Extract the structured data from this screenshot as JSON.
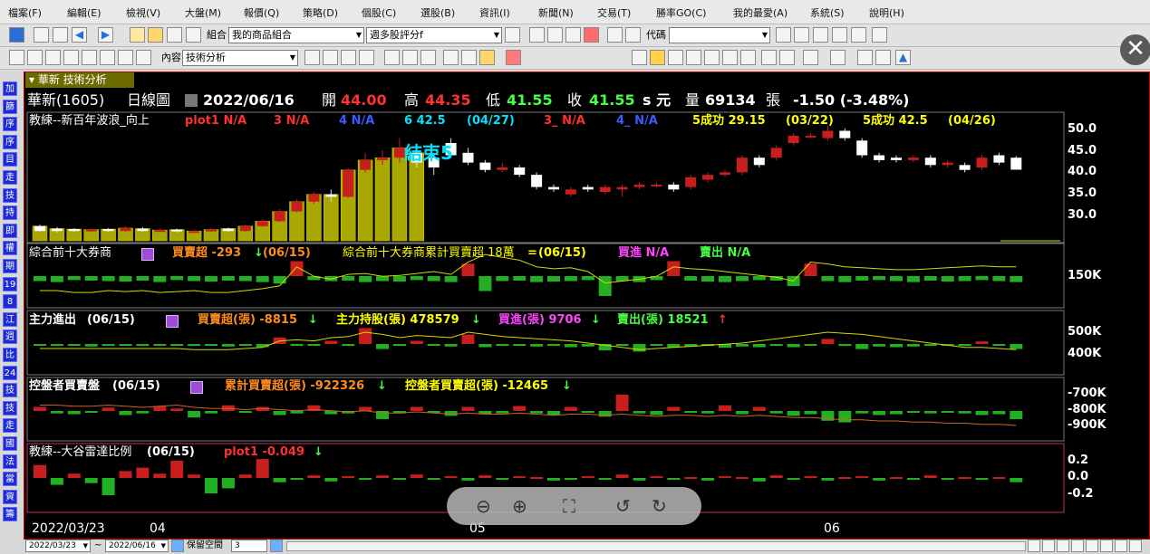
{
  "menu": [
    "檔案(F)",
    "編輯(E)",
    "檢視(V)",
    "大盤(M)",
    "報價(Q)",
    "策略(D)",
    "個股(C)",
    "選股(B)",
    "資訊(I)",
    "新聞(N)",
    "交易(T)",
    "勝率GO(C)",
    "我的最愛(A)",
    "系統(S)",
    "說明(H)"
  ],
  "toolbar1": {
    "combo_label": "組合",
    "combo_value": "我的商品組合",
    "strategy_value": "週多股評分f",
    "code_label": "代碼",
    "code_value": ""
  },
  "toolbar2": {
    "content_label": "內容",
    "content_value": "技術分析"
  },
  "left_buttons": [
    "加",
    "篩",
    "序",
    "序",
    "目",
    "走",
    "技",
    "持",
    "即",
    "權",
    "期",
    "19",
    "8",
    "江",
    "週",
    "比",
    "24",
    "技",
    "技",
    "走",
    "國",
    "法",
    "當",
    "資",
    "籌"
  ],
  "tab": {
    "title": "華新 技術分析"
  },
  "header": {
    "name": "華新(1605)",
    "period": "日線圖",
    "date": "2022/06/16",
    "open_label": "開",
    "open": "44.00",
    "high_label": "高",
    "high": "44.35",
    "low_label": "低",
    "low": "41.55",
    "close_label": "收",
    "close": "41.55",
    "unit": "s 元",
    "vol_label": "量",
    "vol": "69134",
    "vol_unit": "張",
    "change": "-1.50 (-3.48%)"
  },
  "panel1": {
    "title": "教練--新百年波浪_向上",
    "items": [
      {
        "text": "plot1 N/A",
        "color": "#ff3030"
      },
      {
        "text": "3 N/A",
        "color": "#ff3030"
      },
      {
        "text": "4 N/A",
        "color": "#3a5bff"
      },
      {
        "text": "6 42.5",
        "color": "#00e5ff"
      },
      {
        "text": "(04/27)",
        "color": "#00e5ff"
      },
      {
        "text": "3_ N/A",
        "color": "#ff3030"
      },
      {
        "text": "4_ N/A",
        "color": "#3a5bff"
      },
      {
        "text": "5成功 29.15",
        "color": "#ffff00"
      },
      {
        "text": "(03/22)",
        "color": "#ffff00"
      },
      {
        "text": "5成功 42.5",
        "color": "#ffff00"
      },
      {
        "text": "(04/26)",
        "color": "#ffff00"
      }
    ],
    "marker": "結束5",
    "yticks": [
      "50.0",
      "45.0",
      "40.0",
      "35.0",
      "30.0"
    ]
  },
  "panel2": {
    "title": "綜合前十大券商",
    "items": [
      {
        "text": "買賣超 -293",
        "color": "#ff8c1a"
      },
      {
        "text": "(06/15)",
        "color": "#ff8c1a"
      },
      {
        "text": "綜合前十大券商累計買賣超 18萬",
        "color": "#ffff00"
      },
      {
        "text": "(06/15)",
        "color": "#ffff00"
      },
      {
        "text": "買進 N/A",
        "color": "#ff44ff"
      },
      {
        "text": "賣出 N/A",
        "color": "#44ff44"
      }
    ],
    "yticks": [
      "150K"
    ]
  },
  "panel3": {
    "title": "主力進出",
    "date": "(06/15)",
    "items": [
      {
        "text": "買賣超(張) -8815",
        "color": "#ff8c1a"
      },
      {
        "text": "主力持股(張) 478579",
        "color": "#ffff00"
      },
      {
        "text": "買進(張) 9706",
        "color": "#ff44ff"
      },
      {
        "text": "賣出(張) 18521",
        "color": "#44ff44"
      }
    ],
    "yticks": [
      "500K",
      "400K"
    ]
  },
  "panel4": {
    "title": "控盤者買賣盤",
    "date": "(06/15)",
    "items": [
      {
        "text": "累計買賣超(張) -922326",
        "color": "#ff8c1a"
      },
      {
        "text": "控盤者買賣超(張) -12465",
        "color": "#ffff00"
      }
    ],
    "yticks": [
      "-700K",
      "-800K",
      "-900K"
    ]
  },
  "panel5": {
    "title": "教練--大谷雷達比例",
    "date": "(06/15)",
    "items": [
      {
        "text": "plot1 -0.049",
        "color": "#ff3030"
      }
    ],
    "yticks": [
      "0.2",
      "0.0",
      "-0.2"
    ]
  },
  "xaxis": [
    "2022/03/23",
    "04",
    "05",
    "06"
  ],
  "bottom": {
    "from": "2022/03/23",
    "tilde": "~",
    "to": "2022/06/16",
    "reserve_label": "保留空間",
    "reserve_value": "3"
  },
  "colors": {
    "up": "#c81e1e",
    "down": "#ffffff",
    "highlight": "#a8a800",
    "grid": "#7a7a7a"
  },
  "chart_data": {
    "type": "candlestick",
    "title": "華新(1605) 日線圖",
    "ylim": [
      27,
      52
    ],
    "highlight_count": 23,
    "candles": [
      {
        "o": 30,
        "c": 29,
        "h": 30.3,
        "l": 28.8
      },
      {
        "o": 29.5,
        "c": 29,
        "h": 29.8,
        "l": 28.7
      },
      {
        "o": 29.4,
        "c": 29,
        "h": 29.6,
        "l": 28.8
      },
      {
        "o": 29,
        "c": 29.3,
        "h": 29.5,
        "l": 28.8
      },
      {
        "o": 29.4,
        "c": 29,
        "h": 29.6,
        "l": 28.8
      },
      {
        "o": 29,
        "c": 29.6,
        "h": 30,
        "l": 28.8
      },
      {
        "o": 29.5,
        "c": 29,
        "h": 29.8,
        "l": 28.8
      },
      {
        "o": 29,
        "c": 29.2,
        "h": 29.5,
        "l": 28.8
      },
      {
        "o": 29.3,
        "c": 29,
        "h": 29.5,
        "l": 28.7
      },
      {
        "o": 28.9,
        "c": 29,
        "h": 29.3,
        "l": 28.6
      },
      {
        "o": 29,
        "c": 29.3,
        "h": 29.6,
        "l": 28.8
      },
      {
        "o": 29.5,
        "c": 29,
        "h": 29.7,
        "l": 28.8
      },
      {
        "o": 29,
        "c": 30,
        "h": 30.3,
        "l": 28.8
      },
      {
        "o": 30,
        "c": 31,
        "h": 31.4,
        "l": 29.8
      },
      {
        "o": 31,
        "c": 33,
        "h": 33.5,
        "l": 30.8
      },
      {
        "o": 33,
        "c": 35,
        "h": 35.5,
        "l": 32.8
      },
      {
        "o": 35,
        "c": 36.5,
        "h": 37,
        "l": 34.5
      },
      {
        "o": 36.5,
        "c": 36,
        "h": 37.5,
        "l": 35
      },
      {
        "o": 36,
        "c": 41.5,
        "h": 41.8,
        "l": 35.8
      },
      {
        "o": 41.5,
        "c": 43.5,
        "h": 45,
        "l": 41
      },
      {
        "o": 43.5,
        "c": 44,
        "h": 45.5,
        "l": 42.5
      },
      {
        "o": 44,
        "c": 46,
        "h": 48,
        "l": 43
      },
      {
        "o": 45,
        "c": 43,
        "h": 46.5,
        "l": 42
      },
      {
        "o": 44,
        "c": 42,
        "h": 45,
        "l": 40.5
      },
      {
        "o": 47,
        "c": 44.5,
        "h": 48,
        "l": 44
      },
      {
        "o": 45,
        "c": 43,
        "h": 46,
        "l": 42.5
      },
      {
        "o": 43,
        "c": 41.5,
        "h": 43.5,
        "l": 41
      },
      {
        "o": 41.5,
        "c": 42,
        "h": 43,
        "l": 41
      },
      {
        "o": 42,
        "c": 40.5,
        "h": 42.5,
        "l": 40
      },
      {
        "o": 40.5,
        "c": 38,
        "h": 41,
        "l": 37.5
      },
      {
        "o": 38,
        "c": 37.5,
        "h": 38.5,
        "l": 37
      },
      {
        "o": 36.5,
        "c": 37.5,
        "h": 38,
        "l": 36
      },
      {
        "o": 38,
        "c": 37.5,
        "h": 38.5,
        "l": 37
      },
      {
        "o": 37,
        "c": 38,
        "h": 38.5,
        "l": 36.5
      },
      {
        "o": 37.5,
        "c": 38,
        "h": 38.5,
        "l": 36
      },
      {
        "o": 38,
        "c": 38.5,
        "h": 39,
        "l": 37.5
      },
      {
        "o": 38.5,
        "c": 38.5,
        "h": 39,
        "l": 38
      },
      {
        "o": 38.5,
        "c": 37.5,
        "h": 39,
        "l": 37
      },
      {
        "o": 38,
        "c": 40,
        "h": 40.5,
        "l": 37.5
      },
      {
        "o": 39.5,
        "c": 40.5,
        "h": 41,
        "l": 39
      },
      {
        "o": 40.5,
        "c": 41,
        "h": 41.5,
        "l": 40
      },
      {
        "o": 41,
        "c": 44,
        "h": 44.5,
        "l": 40.5
      },
      {
        "o": 44,
        "c": 42.5,
        "h": 44.5,
        "l": 42
      },
      {
        "o": 44,
        "c": 46,
        "h": 46.5,
        "l": 43.5
      },
      {
        "o": 47,
        "c": 48.5,
        "h": 49,
        "l": 46.5
      },
      {
        "o": 48.5,
        "c": 48.5,
        "h": 49,
        "l": 48
      },
      {
        "o": 48,
        "c": 49.5,
        "h": 50.5,
        "l": 47.5
      },
      {
        "o": 49.5,
        "c": 48,
        "h": 50,
        "l": 47.5
      },
      {
        "o": 47.5,
        "c": 44.5,
        "h": 48,
        "l": 44
      },
      {
        "o": 44.5,
        "c": 43.5,
        "h": 45,
        "l": 43
      },
      {
        "o": 44,
        "c": 43.5,
        "h": 44.5,
        "l": 43
      },
      {
        "o": 43.5,
        "c": 44,
        "h": 44.5,
        "l": 43
      },
      {
        "o": 44,
        "c": 42.5,
        "h": 44.5,
        "l": 42
      },
      {
        "o": 42.5,
        "c": 43,
        "h": 43.5,
        "l": 42
      },
      {
        "o": 42.5,
        "c": 41.5,
        "h": 43,
        "l": 41
      },
      {
        "o": 42,
        "c": 44,
        "h": 44.5,
        "l": 41.5
      },
      {
        "o": 44.5,
        "c": 43,
        "h": 45,
        "l": 42.5
      },
      {
        "o": 44,
        "c": 41.55,
        "h": 44.35,
        "l": 41.55
      }
    ],
    "broker_net": [
      -10,
      -12,
      -8,
      -9,
      -10,
      -11,
      -9,
      -12,
      -8,
      -10,
      -11,
      -9,
      -10,
      -12,
      -15,
      30,
      -8,
      -10,
      -9,
      -12,
      -10,
      -11,
      -8,
      -10,
      -12,
      25,
      -30,
      -10,
      -9,
      -12,
      -11,
      -10,
      -8,
      -40,
      -10,
      -12,
      -8,
      30,
      -9,
      -11,
      -12,
      -10,
      -8,
      -9,
      -20,
      25,
      -10,
      -12,
      -9,
      -8,
      -10,
      -12,
      -9,
      -11,
      -10,
      -8,
      -10,
      -12
    ],
    "broker_cum": [
      -20,
      -20,
      -22,
      -22,
      -20,
      -21,
      -20,
      -22,
      -21,
      -20,
      -22,
      -22,
      -20,
      -18,
      -15,
      5,
      -5,
      -8,
      -3,
      -2,
      -5,
      -4,
      -2,
      0,
      -3,
      10,
      18,
      15,
      12,
      5,
      3,
      4,
      0,
      -12,
      -10,
      -8,
      -5,
      5,
      3,
      2,
      0,
      -2,
      -4,
      -6,
      -10,
      10,
      8,
      5,
      4,
      3,
      2,
      2,
      3,
      4,
      5,
      6,
      5,
      5
    ],
    "main_net": [
      -2,
      -3,
      -2,
      -4,
      -3,
      -2,
      -3,
      -2,
      -2,
      -3,
      -2,
      -4,
      -2,
      -5,
      10,
      -3,
      -2,
      5,
      -3,
      25,
      -8,
      -3,
      5,
      -2,
      -4,
      15,
      -5,
      -3,
      -2,
      -4,
      -3,
      -5,
      -4,
      -10,
      -3,
      -12,
      -2,
      -5,
      -4,
      -3,
      -6,
      -4,
      -5,
      -3,
      -5,
      -2,
      8,
      -3,
      -8,
      -4,
      -5,
      -4,
      -3,
      -2,
      -3,
      4,
      -2,
      -8
    ],
    "main_hold": [
      -5,
      -5,
      -5,
      -5,
      -5,
      -5,
      -5,
      -5,
      -5,
      -6,
      -6,
      -6,
      -5,
      -4,
      2,
      3,
      2,
      5,
      6,
      10,
      8,
      5,
      7,
      6,
      5,
      10,
      8,
      6,
      5,
      4,
      3,
      2,
      0,
      -2,
      -4,
      -6,
      -5,
      -4,
      -3,
      -2,
      -1,
      0,
      2,
      4,
      6,
      8,
      10,
      9,
      8,
      6,
      4,
      2,
      0,
      -2,
      -4,
      -4,
      -5,
      -6
    ],
    "ctrl_net": [
      5,
      -3,
      -4,
      -2,
      4,
      -5,
      -3,
      6,
      3,
      -8,
      -3,
      7,
      -2,
      5,
      -5,
      -3,
      7,
      -4,
      -3,
      5,
      -10,
      -3,
      5,
      -2,
      -6,
      5,
      -4,
      -3,
      6,
      -3,
      -5,
      5,
      -2,
      -7,
      20,
      -3,
      -5,
      5,
      -2,
      -3,
      7,
      -4,
      5,
      -3,
      -6,
      -4,
      -12,
      -14,
      -3,
      -5,
      -4,
      -2,
      -3,
      -2,
      -3,
      -5,
      -4,
      -10
    ],
    "ctrl_cum": [
      2,
      2,
      1,
      1,
      2,
      1,
      0,
      1,
      2,
      0,
      -1,
      -1,
      -2,
      -1,
      -2,
      -3,
      -2,
      -3,
      -4,
      -3,
      -5,
      -5,
      -4,
      -5,
      -6,
      -5,
      -6,
      -6,
      -5,
      -6,
      -7,
      -6,
      -6,
      -7,
      -6,
      -7,
      -8,
      -7,
      -7,
      -8,
      -7,
      -8,
      -7,
      -8,
      -9,
      -9,
      -10,
      -11,
      -11,
      -12,
      -12,
      -13,
      -13,
      -14,
      -14,
      -15,
      -15,
      -16
    ],
    "ratio": [
      0.15,
      -0.08,
      0.05,
      -0.06,
      -0.2,
      0.08,
      0.12,
      0.05,
      0.2,
      0.04,
      -0.18,
      -0.12,
      0.04,
      0.22,
      -0.05,
      -0.02,
      0.03,
      -0.04,
      0.02,
      -0.01,
      0.03,
      -0.02,
      0.04,
      -0.02,
      0.02,
      -0.03,
      0.03,
      -0.02,
      0.02,
      0.01,
      -0.03,
      -0.02,
      0.02,
      -0.02,
      0.04,
      -0.03,
      0.02,
      -0.02,
      0.01,
      -0.03,
      0.02,
      0.01,
      -0.04,
      0.03,
      -0.02,
      0.02,
      -0.03,
      0.01,
      0.02,
      -0.03,
      0.01,
      -0.02,
      0.03,
      -0.02,
      0.01,
      -0.02,
      0.01,
      -0.049
    ]
  }
}
